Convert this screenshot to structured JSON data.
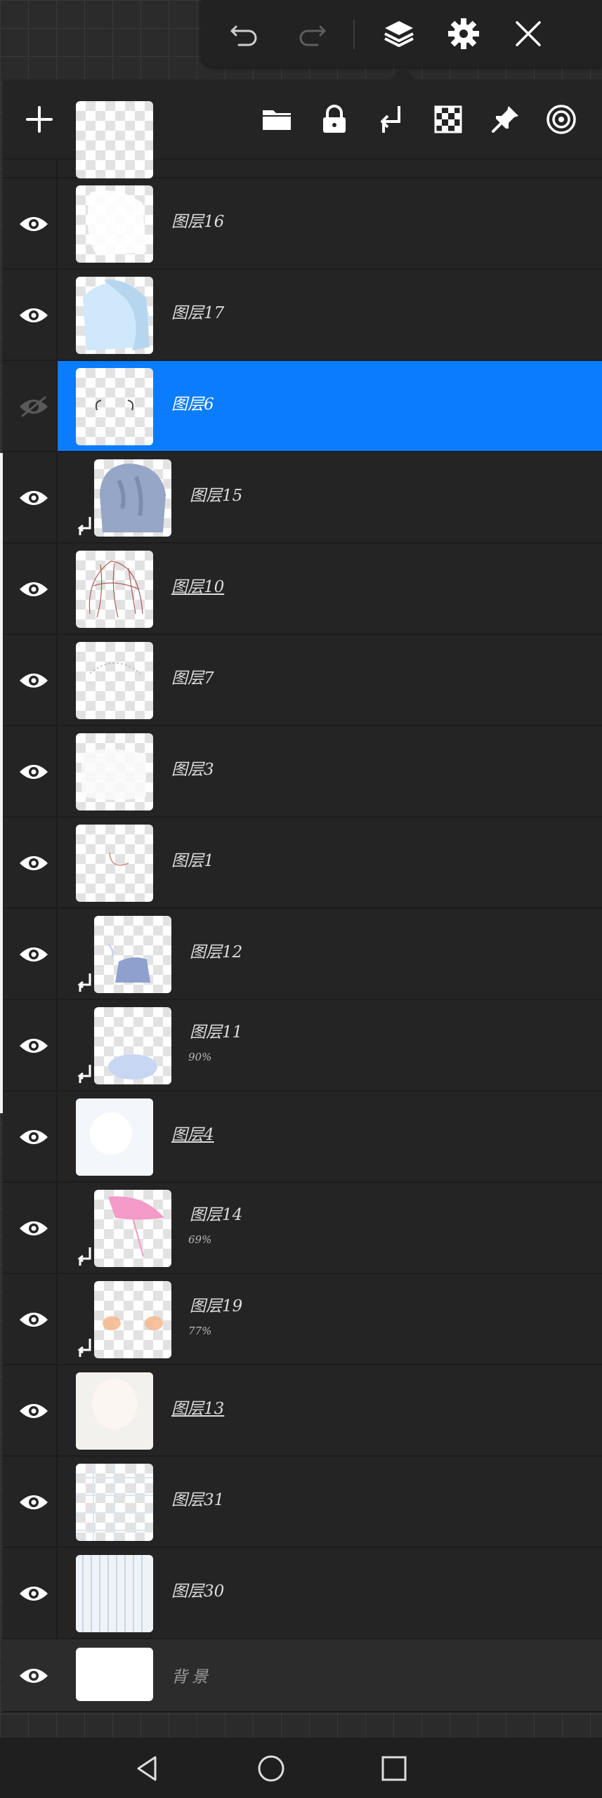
{
  "toolbar": {
    "icons": [
      "undo-icon",
      "redo-icon",
      "layers-icon",
      "gear-icon",
      "close-icon"
    ]
  },
  "layer_panel": {
    "toolbar_icons": [
      "plus-icon",
      "folder-icon",
      "lock-icon",
      "clip-arrow-icon",
      "checkerboard-icon",
      "pin-icon",
      "blend-mode-icon"
    ],
    "layers": [
      {
        "name": "图层16",
        "visible": true
      },
      {
        "name": "图层17",
        "visible": true
      },
      {
        "name": "图层6",
        "visible": false,
        "selected": true
      },
      {
        "name": "图层15",
        "visible": true,
        "clipped": true
      },
      {
        "name": "图层10",
        "visible": true,
        "underlined": true
      },
      {
        "name": "图层7",
        "visible": true
      },
      {
        "name": "图层3",
        "visible": true
      },
      {
        "name": "图层1",
        "visible": true
      },
      {
        "name": "图层12",
        "visible": true,
        "clipped": true
      },
      {
        "name": "图层11",
        "visible": true,
        "clipped": true,
        "opacity": "90%"
      },
      {
        "name": "图层4",
        "visible": true,
        "underlined": true
      },
      {
        "name": "图层14",
        "visible": true,
        "clipped": true,
        "opacity": "69%"
      },
      {
        "name": "图层19",
        "visible": true,
        "clipped": true,
        "opacity": "77%"
      },
      {
        "name": "图层13",
        "visible": true,
        "underlined": true
      },
      {
        "name": "图层31",
        "visible": true
      },
      {
        "name": "图层30",
        "visible": true
      },
      {
        "name": "背景",
        "visible": true,
        "background": true
      }
    ]
  },
  "colors": {
    "selected": "#0a7cff",
    "panel": "#242424"
  },
  "nav": {
    "icons": [
      "back-icon",
      "home-icon",
      "recents-icon"
    ]
  }
}
